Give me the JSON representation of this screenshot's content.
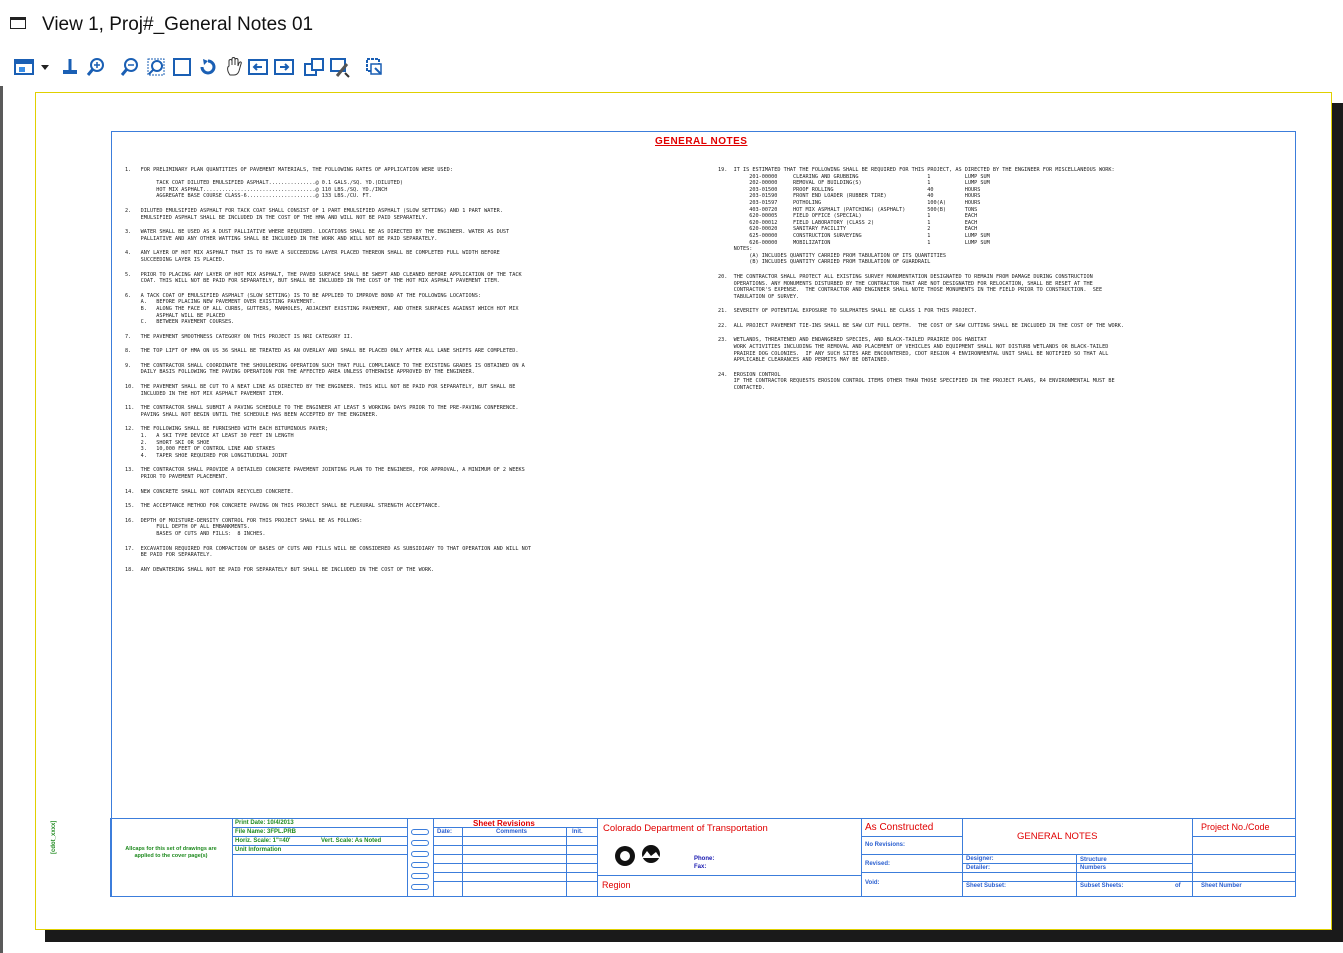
{
  "window": {
    "title": "View 1, Proj#_General Notes 01"
  },
  "toolbar": {
    "icons": [
      "view-groups-icon",
      "dropdown-arrow-icon",
      "update-view-icon",
      "zoom-in-icon",
      "zoom-out-icon",
      "window-area-icon",
      "fit-view-icon",
      "rotate-view-icon",
      "pan-view-icon",
      "previous-view-icon",
      "next-view-icon",
      "copy-view-icon",
      "view-attributes-icon",
      "clip-volume-icon"
    ]
  },
  "sheet": {
    "title": "GENERAL NOTES",
    "left_notes": [
      "1.   FOR PRELIMINARY PLAN QUANTITIES OF PAVEMENT MATERIALS, THE FOLLOWING RATES OF APPLICATION WERE USED:\n\n          TACK COAT DILUTED EMULSIFIED ASPHALT...............@ 0.1 GALS./SQ. YD.(DILUTED)\n          HOT MIX ASPHALT....................................@ 110 LBS./SQ. YD./INCH\n          AGGREGATE BASE COURSE CLASS-6......................@ 133 LBS./CU. FT.",
      "2.   DILUTED EMULSIFIED ASPHALT FOR TACK COAT SHALL CONSIST OF 1 PART EMULSIFIED ASPHALT (SLOW SETTING) AND 1 PART WATER.\n     EMULSIFIED ASPHALT SHALL BE INCLUDED IN THE COST OF THE HMA AND WILL NOT BE PAID SEPARATELY.",
      "3.   WATER SHALL BE USED AS A DUST PALLIATIVE WHERE REQUIRED. LOCATIONS SHALL BE AS DIRECTED BY THE ENGINEER. WATER AS DUST\n     PALLIATIVE AND ANY OTHER WATTING SHALL BE INCLUDED IN THE WORK AND WILL NOT BE PAID SEPARATELY.",
      "4.   ANY LAYER OF HOT MIX ASPHALT THAT IS TO HAVE A SUCCEEDING LAYER PLACED THEREON SHALL BE COMPLETED FULL WIDTH BEFORE\n     SUCCEEDING LAYER IS PLACED.",
      "5.   PRIOR TO PLACING ANY LAYER OF HOT MIX ASPHALT, THE PAVED SURFACE SHALL BE SWEPT AND CLEANED BEFORE APPLICATION OF THE TACK\n     COAT. THIS WILL NOT BE PAID FOR SEPARATELY, BUT SHALL BE INCLUDED IN THE COST OF THE HOT MIX ASPHALT PAVEMENT ITEM.",
      "6.   A TACK COAT OF EMULSIFIED ASPHALT (SLOW SETTING) IS TO BE APPLIED TO IMPROVE BOND AT THE FOLLOWING LOCATIONS:\n     A.   BEFORE PLACING NEW PAVEMENT OVER EXISTING PAVEMENT.\n     B.   ALONG THE FACE OF ALL CURBS, GUTTERS, MANHOLES, ADJACENT EXISTING PAVEMENT, AND OTHER SURFACES AGAINST WHICH HOT MIX\n          ASPHALT WILL BE PLACED\n     C.   BETWEEN PAVEMENT COURSES.",
      "7.   THE PAVEMENT SMOOTHNESS CATEGORY ON THIS PROJECT IS NRI CATEGORY II.",
      "8.   THE TOP LIFT OF HMA ON US 36 SHALL BE TREATED AS AN OVERLAY AND SHALL BE PLACED ONLY AFTER ALL LANE SHIFTS ARE COMPLETED.",
      "9.   THE CONTRACTOR SHALL COORDINATE THE SHOULDERING OPERATION SUCH THAT FULL COMPLIANCE TO THE EXISTING GRADES IS OBTAINED ON A\n     DAILY BASIS FOLLOWING THE PAVING OPERATION FOR THE AFFECTED AREA UNLESS OTHERWISE APPROVED BY THE ENGINEER.",
      "10.  THE PAVEMENT SHALL BE CUT TO A NEAT LINE AS DIRECTED BY THE ENGINEER. THIS WILL NOT BE PAID FOR SEPARATELY, BUT SHALL BE\n     INCLUDED IN THE HOT MIX ASPHALT PAVEMENT ITEM.",
      "11.  THE CONTRACTOR SHALL SUBMIT A PAVING SCHEDULE TO THE ENGINEER AT LEAST 5 WORKING DAYS PRIOR TO THE PRE-PAVING CONFERENCE.\n     PAVING SHALL NOT BEGIN UNTIL THE SCHEDULE HAS BEEN ACCEPTED BY THE ENGINEER.",
      "12.  THE FOLLOWING SHALL BE FURNISHED WITH EACH BITUMINOUS PAVER;\n     1.   A SKI TYPE DEVICE AT LEAST 30 FEET IN LENGTH\n     2.   SHORT SKI OR SHOE\n     3.   10,000 FEET OF CONTROL LINE AND STAKES\n     4.   TAPER SHOE REQUIRED FOR LONGITUDINAL JOINT",
      "13.  THE CONTRACTOR SHALL PROVIDE A DETAILED CONCRETE PAVEMENT JOINTING PLAN TO THE ENGINEER, FOR APPROVAL, A MINIMUM OF 2 WEEKS\n     PRIOR TO PAVEMENT PLACEMENT.",
      "14.  NEW CONCRETE SHALL NOT CONTAIN RECYCLED CONCRETE.",
      "15.  THE ACCEPTANCE METHOD FOR CONCRETE PAVING ON THIS PROJECT SHALL BE FLEXURAL STRENGTH ACCEPTANCE.",
      "16.  DEPTH OF MOISTURE-DENSITY CONTROL FOR THIS PROJECT SHALL BE AS FOLLOWS:\n          FULL DEPTH OF ALL EMBANKMENTS.\n          BASES OF CUTS AND FILLS:  8 INCHES.",
      "17.  EXCAVATION REQUIRED FOR COMPACTION OF BASES OF CUTS AND FILLS WILL BE CONSIDERED AS SUBSIDIARY TO THAT OPERATION AND WILL NOT\n     BE PAID FOR SEPARATELY.",
      "18.  ANY DEWATERING SHALL NOT BE PAID FOR SEPARATELY BUT SHALL BE INCLUDED IN THE COST OF THE WORK."
    ],
    "right_notes": [
      "19.  IT IS ESTIMATED THAT THE FOLLOWING SHALL BE REQUIRED FOR THIS PROJECT, AS DIRECTED BY THE ENGINEER FOR MISCELLANEOUS WORK:\n          201-00000     CLEARING AND GRUBBING                      1           LUMP SUM\n          202-00000     REMOVAL OF BUILDING(S)                     1           LUMP SUM\n          203-01500     PROOF ROLLING                              40          HOURS\n          203-01590     FRONT END LOADER (RUBBER TIRE)             40          HOURS\n          203-01597     POTHOLING                                  100(A)      HOURS\n          403-00720     HOT MIX ASPHALT (PATCHING) (ASPHALT)       500(B)      TONS\n          620-00005     FIELD OFFICE (SPECIAL)                     1           EACH\n          620-00012     FIELD LABORATORY (CLASS 2)                 1           EACH\n          620-00020     SANITARY FACILITY                          2           EACH\n          625-00000     CONSTRUCTION SURVEYING                     1           LUMP SUM\n          626-00000     MOBILIZATION                               1           LUMP SUM\n     NOTES:\n          (A) INCLUDES QUANTITY CARRIED FROM TABULATION OF ITS QUANTITIES\n          (B) INCLUDES QUANTITY CARRIED FROM TABULATION OF GUARDRAIL",
      "20.  THE CONTRACTOR SHALL PROTECT ALL EXISTING SURVEY MONUMENTATION DESIGNATED TO REMAIN FROM DAMAGE DURING CONSTRUCTION\n     OPERATIONS. ANY MONUMENTS DISTURBED BY THE CONTRACTOR THAT ARE NOT DESIGNATED FOR RELOCATION, SHALL BE RESET AT THE\n     CONTRACTOR'S EXPENSE.  THE CONTRACTOR AND ENGINEER SHALL NOTE THOSE MONUMENTS IN THE FIELD PRIOR TO CONSTRUCTION.  SEE\n     TABULATION OF SURVEY.",
      "21.  SEVERITY OF POTENTIAL EXPOSURE TO SULPHATES SHALL BE CLASS 1 FOR THIS PROJECT.",
      "22.  ALL PROJECT PAVEMENT TIE-INS SHALL BE SAW CUT FULL DEPTH.  THE COST OF SAW CUTTING SHALL BE INCLUDED IN THE COST OF THE WORK.",
      "23.  WETLANDS, THREATENED AND ENDANGERED SPECIES, AND BLACK-TAILED PRAIRIE DOG HABITAT\n     WORK ACTIVITIES INCLUDING THE REMOVAL AND PLACEMENT OF VEHICLES AND EQUIPMENT SHALL NOT DISTURB WETLANDS OR BLACK-TAILED\n     PRAIRIE DOG COLONIES.  IF ANY SUCH SITES ARE ENCOUNTERED, CDOT REGION 4 ENVIRONMENTAL UNIT SHALL BE NOTIFIED SO THAT ALL\n     APPLICABLE CLEARANCES AND PERMITS MAY BE OBTAINED.",
      "24.  EROSION CONTROL\n     IF THE CONTRACTOR REQUESTS EROSION CONTROL ITEMS OTHER THAN THOSE SPECIFIED IN THE PROJECT PLANS, R4 ENVIRONMENTAL MUST BE\n     CONTACTED."
    ],
    "titleblock": {
      "side_label": "[cdot_xxxx]",
      "cover_note": "Allcaps for this set of drawings are applied to the cover page(s)",
      "print_date": "Print Date: 10/4/2013",
      "file_name": "File Name: 3FPL.PRB",
      "horiz_scale": "Horiz. Scale: 1\"=40'",
      "vert_scale": "Vert. Scale: As Noted",
      "unit_info": "Unit Information",
      "sheet_revisions": "Sheet Revisions",
      "date_hdr": "Date:",
      "comments_hdr": "Comments",
      "init_hdr": "Init.",
      "dept": "Colorado Department of Transportation",
      "phone": "Phone:",
      "fax": "Fax:",
      "region": "Region",
      "as_constructed": "As Constructed",
      "no_revisions": "No Revisions:",
      "revised": "Revised:",
      "void": "Void:",
      "sheet_title": "GENERAL NOTES",
      "designer": "Designer:",
      "detailer": "Detailer:",
      "sheet_subset": "Sheet Subset:",
      "structure_numbers_1": "Structure",
      "structure_numbers_2": "Numbers",
      "subset_sheets": "Subset Sheets:",
      "of": "of",
      "project_no": "Project No./Code",
      "sheet_number": "Sheet Number"
    }
  }
}
